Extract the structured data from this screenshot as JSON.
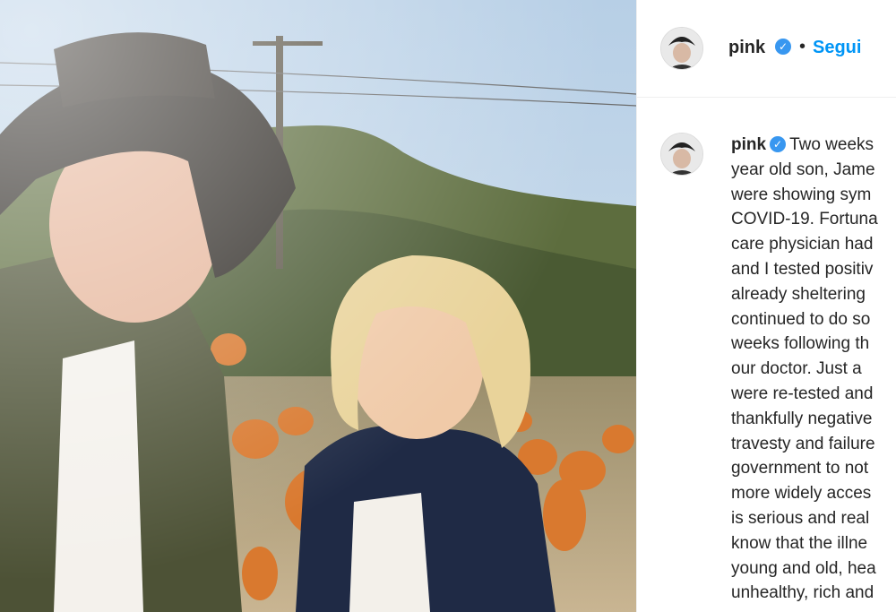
{
  "post": {
    "username": "pink",
    "verified_icon": "verified-badge-icon",
    "separator": "•",
    "follow_label": "Segui",
    "accent_color": "#0095f6",
    "caption_lines": [
      "Two weeks",
      "year old son, Jame",
      "were showing sym",
      "COVID-19. Fortuna",
      "care physician had",
      "and I tested positiv",
      "already sheltering",
      "continued to do so",
      "weeks following th",
      "our doctor. Just a",
      "were re-tested and",
      "thankfully negative",
      "travesty and failure",
      "government to not",
      "more widely acces",
      "is serious and real",
      "know that the illne",
      "young and old, hea",
      "unhealthy, rich and"
    ]
  }
}
